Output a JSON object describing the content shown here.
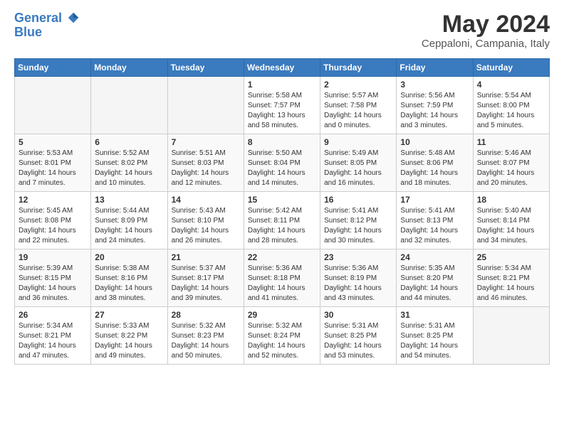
{
  "header": {
    "logo_line1": "General",
    "logo_line2": "Blue",
    "title": "May 2024",
    "subtitle": "Ceppaloni, Campania, Italy"
  },
  "days_of_week": [
    "Sunday",
    "Monday",
    "Tuesday",
    "Wednesday",
    "Thursday",
    "Friday",
    "Saturday"
  ],
  "weeks": [
    [
      {
        "num": "",
        "info": ""
      },
      {
        "num": "",
        "info": ""
      },
      {
        "num": "",
        "info": ""
      },
      {
        "num": "1",
        "info": "Sunrise: 5:58 AM\nSunset: 7:57 PM\nDaylight: 13 hours\nand 58 minutes."
      },
      {
        "num": "2",
        "info": "Sunrise: 5:57 AM\nSunset: 7:58 PM\nDaylight: 14 hours\nand 0 minutes."
      },
      {
        "num": "3",
        "info": "Sunrise: 5:56 AM\nSunset: 7:59 PM\nDaylight: 14 hours\nand 3 minutes."
      },
      {
        "num": "4",
        "info": "Sunrise: 5:54 AM\nSunset: 8:00 PM\nDaylight: 14 hours\nand 5 minutes."
      }
    ],
    [
      {
        "num": "5",
        "info": "Sunrise: 5:53 AM\nSunset: 8:01 PM\nDaylight: 14 hours\nand 7 minutes."
      },
      {
        "num": "6",
        "info": "Sunrise: 5:52 AM\nSunset: 8:02 PM\nDaylight: 14 hours\nand 10 minutes."
      },
      {
        "num": "7",
        "info": "Sunrise: 5:51 AM\nSunset: 8:03 PM\nDaylight: 14 hours\nand 12 minutes."
      },
      {
        "num": "8",
        "info": "Sunrise: 5:50 AM\nSunset: 8:04 PM\nDaylight: 14 hours\nand 14 minutes."
      },
      {
        "num": "9",
        "info": "Sunrise: 5:49 AM\nSunset: 8:05 PM\nDaylight: 14 hours\nand 16 minutes."
      },
      {
        "num": "10",
        "info": "Sunrise: 5:48 AM\nSunset: 8:06 PM\nDaylight: 14 hours\nand 18 minutes."
      },
      {
        "num": "11",
        "info": "Sunrise: 5:46 AM\nSunset: 8:07 PM\nDaylight: 14 hours\nand 20 minutes."
      }
    ],
    [
      {
        "num": "12",
        "info": "Sunrise: 5:45 AM\nSunset: 8:08 PM\nDaylight: 14 hours\nand 22 minutes."
      },
      {
        "num": "13",
        "info": "Sunrise: 5:44 AM\nSunset: 8:09 PM\nDaylight: 14 hours\nand 24 minutes."
      },
      {
        "num": "14",
        "info": "Sunrise: 5:43 AM\nSunset: 8:10 PM\nDaylight: 14 hours\nand 26 minutes."
      },
      {
        "num": "15",
        "info": "Sunrise: 5:42 AM\nSunset: 8:11 PM\nDaylight: 14 hours\nand 28 minutes."
      },
      {
        "num": "16",
        "info": "Sunrise: 5:41 AM\nSunset: 8:12 PM\nDaylight: 14 hours\nand 30 minutes."
      },
      {
        "num": "17",
        "info": "Sunrise: 5:41 AM\nSunset: 8:13 PM\nDaylight: 14 hours\nand 32 minutes."
      },
      {
        "num": "18",
        "info": "Sunrise: 5:40 AM\nSunset: 8:14 PM\nDaylight: 14 hours\nand 34 minutes."
      }
    ],
    [
      {
        "num": "19",
        "info": "Sunrise: 5:39 AM\nSunset: 8:15 PM\nDaylight: 14 hours\nand 36 minutes."
      },
      {
        "num": "20",
        "info": "Sunrise: 5:38 AM\nSunset: 8:16 PM\nDaylight: 14 hours\nand 38 minutes."
      },
      {
        "num": "21",
        "info": "Sunrise: 5:37 AM\nSunset: 8:17 PM\nDaylight: 14 hours\nand 39 minutes."
      },
      {
        "num": "22",
        "info": "Sunrise: 5:36 AM\nSunset: 8:18 PM\nDaylight: 14 hours\nand 41 minutes."
      },
      {
        "num": "23",
        "info": "Sunrise: 5:36 AM\nSunset: 8:19 PM\nDaylight: 14 hours\nand 43 minutes."
      },
      {
        "num": "24",
        "info": "Sunrise: 5:35 AM\nSunset: 8:20 PM\nDaylight: 14 hours\nand 44 minutes."
      },
      {
        "num": "25",
        "info": "Sunrise: 5:34 AM\nSunset: 8:21 PM\nDaylight: 14 hours\nand 46 minutes."
      }
    ],
    [
      {
        "num": "26",
        "info": "Sunrise: 5:34 AM\nSunset: 8:21 PM\nDaylight: 14 hours\nand 47 minutes."
      },
      {
        "num": "27",
        "info": "Sunrise: 5:33 AM\nSunset: 8:22 PM\nDaylight: 14 hours\nand 49 minutes."
      },
      {
        "num": "28",
        "info": "Sunrise: 5:32 AM\nSunset: 8:23 PM\nDaylight: 14 hours\nand 50 minutes."
      },
      {
        "num": "29",
        "info": "Sunrise: 5:32 AM\nSunset: 8:24 PM\nDaylight: 14 hours\nand 52 minutes."
      },
      {
        "num": "30",
        "info": "Sunrise: 5:31 AM\nSunset: 8:25 PM\nDaylight: 14 hours\nand 53 minutes."
      },
      {
        "num": "31",
        "info": "Sunrise: 5:31 AM\nSunset: 8:25 PM\nDaylight: 14 hours\nand 54 minutes."
      },
      {
        "num": "",
        "info": ""
      }
    ]
  ]
}
